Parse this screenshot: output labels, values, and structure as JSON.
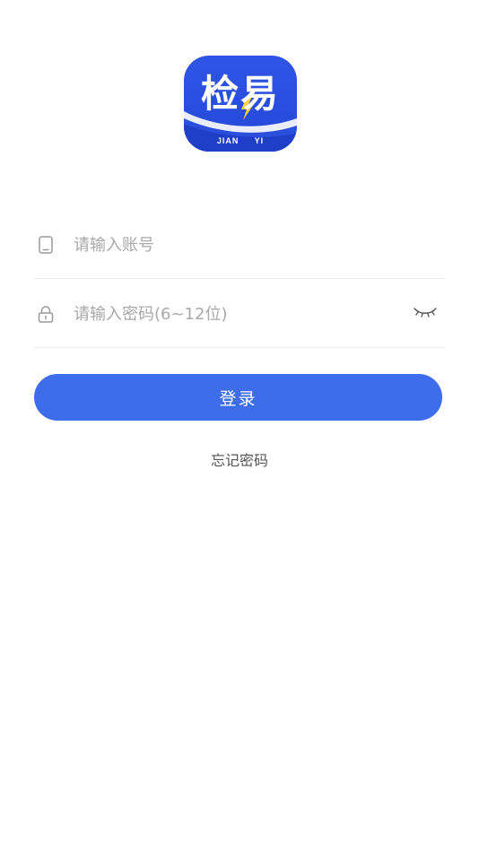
{
  "logo": {
    "title": "检易",
    "subtitle": "JIAN YI",
    "brand_color": "#2f55e6"
  },
  "account_field": {
    "placeholder": "请输入账号",
    "value": "",
    "icon": "phone-icon"
  },
  "password_field": {
    "placeholder": "请输入密码(6~12位)",
    "value": "",
    "icon": "lock-icon",
    "toggle_icon": "eye-closed-icon"
  },
  "login_button": {
    "label": "登录",
    "color": "#3d6deb"
  },
  "forgot_password": {
    "label": "忘记密码"
  }
}
